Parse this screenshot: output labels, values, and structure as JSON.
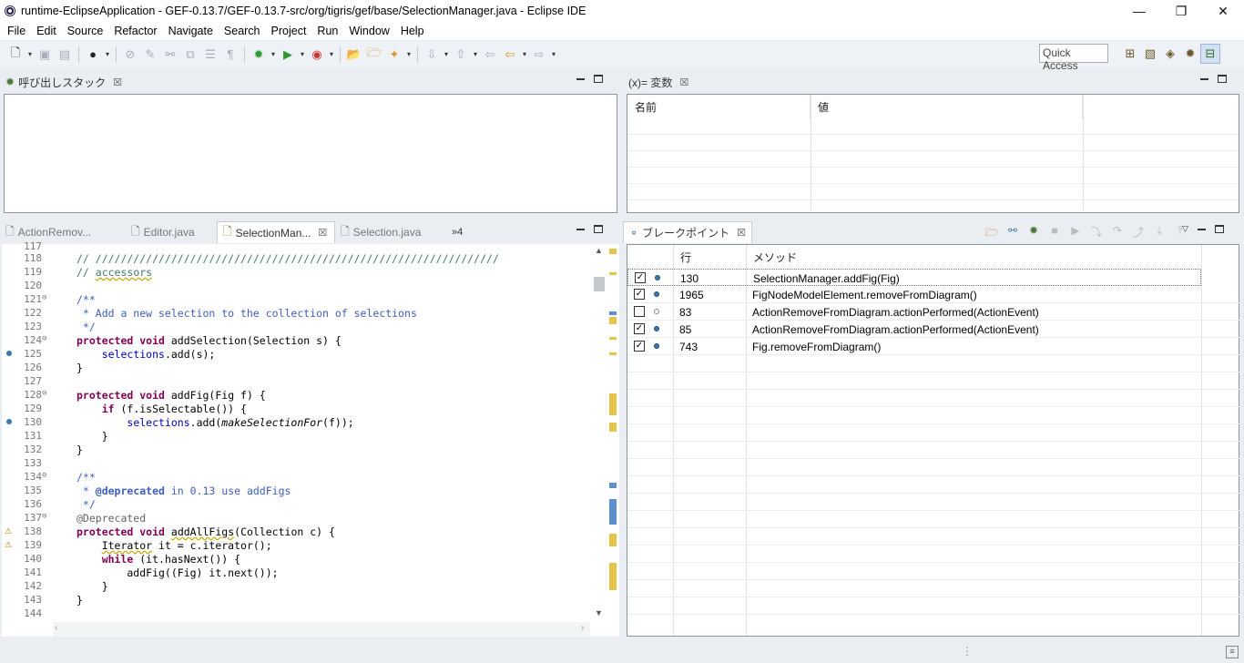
{
  "window": {
    "title": "runtime-EclipseApplication - GEF-0.13.7/GEF-0.13.7-src/org/tigris/gef/base/SelectionManager.java - Eclipse IDE",
    "minimize": "—",
    "restore": "❐",
    "close": "✕"
  },
  "menu": [
    "File",
    "Edit",
    "Source",
    "Refactor",
    "Navigate",
    "Search",
    "Project",
    "Run",
    "Window",
    "Help"
  ],
  "toolbar": {
    "quick_access": "Quick Access"
  },
  "callstack": {
    "tab_label": "呼び出しスタック"
  },
  "variables": {
    "tab_label": "(x)= 変数",
    "columns": [
      "名前",
      "値"
    ]
  },
  "editor": {
    "tabs": [
      "ActionRemov...",
      "Editor.java",
      "SelectionMan...",
      "Selection.java"
    ],
    "overflow": "»4",
    "lines": [
      "117",
      "118",
      "119",
      "120",
      "121",
      "122",
      "123",
      "124",
      "125",
      "126",
      "127",
      "128",
      "129",
      "130",
      "131",
      "132",
      "133",
      "134",
      "135",
      "136",
      "137",
      "138",
      "139",
      "140",
      "141",
      "142",
      "143",
      "144"
    ]
  },
  "breakpoints": {
    "tab_label": "ブレークポイント",
    "columns": [
      "行",
      "メソッド"
    ],
    "rows": [
      {
        "checked": "✓",
        "line": "130",
        "method": "SelectionManager.addFig(Fig)"
      },
      {
        "checked": "✓",
        "line": "1965",
        "method": "FigNodeModelElement.removeFromDiagram()"
      },
      {
        "checked": "",
        "line": "83",
        "method": "ActionRemoveFromDiagram.actionPerformed(ActionEvent)"
      },
      {
        "checked": "✓",
        "line": "85",
        "method": "ActionRemoveFromDiagram.actionPerformed(ActionEvent)"
      },
      {
        "checked": "✓",
        "line": "743",
        "method": "Fig.removeFromDiagram()"
      }
    ]
  },
  "icons": {
    "debug": "bug-icon",
    "breakpoint": "breakpoint-dot-icon",
    "java_file": "java-file-icon"
  }
}
